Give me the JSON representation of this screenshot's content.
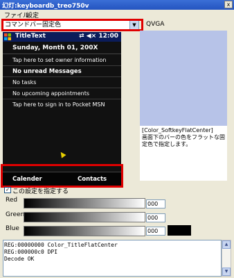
{
  "window": {
    "title": "幻灯:keyboardb_treo750v",
    "close": "x"
  },
  "menubar": {
    "file": "ファイル",
    "settings": "設定"
  },
  "combo": {
    "value": "コマンドバー固定色",
    "arrow": "▼"
  },
  "resolution": "QVGA",
  "device": {
    "title": "TitleText",
    "status": "⇄ ◀× 12:00",
    "date": "Sunday, Month 01, 200X",
    "rows": [
      {
        "text": "Tap here to set owner information",
        "bold": false
      },
      {
        "text": "No unread Messages",
        "bold": true
      },
      {
        "text": "No tasks",
        "bold": false
      },
      {
        "text": "No upcoming appointments",
        "bold": false
      },
      {
        "text": "Tap here to sign in to Pocket MSN",
        "bold": false
      }
    ],
    "softkey_left": "Calender",
    "softkey_right": "Contacts"
  },
  "description": "[Color_SoftkeyFlatCenter]\n画面下のバーの色をフラットな固定色で指定します。",
  "checkbox": {
    "label": "この設定を指定する",
    "checked": "✓"
  },
  "sliders": [
    {
      "label": "Red",
      "value": "000"
    },
    {
      "label": "Green",
      "value": "000"
    },
    {
      "label": "Blue",
      "value": "000"
    }
  ],
  "log": [
    "REG:00000000 Color_TitleFlatCenter",
    "REG:000000c0 DPI",
    "Decode OK"
  ],
  "scroll": {
    "up": "▲",
    "down": "▼"
  },
  "colors": {
    "highlight": "#e00000",
    "preview": "#000000"
  }
}
